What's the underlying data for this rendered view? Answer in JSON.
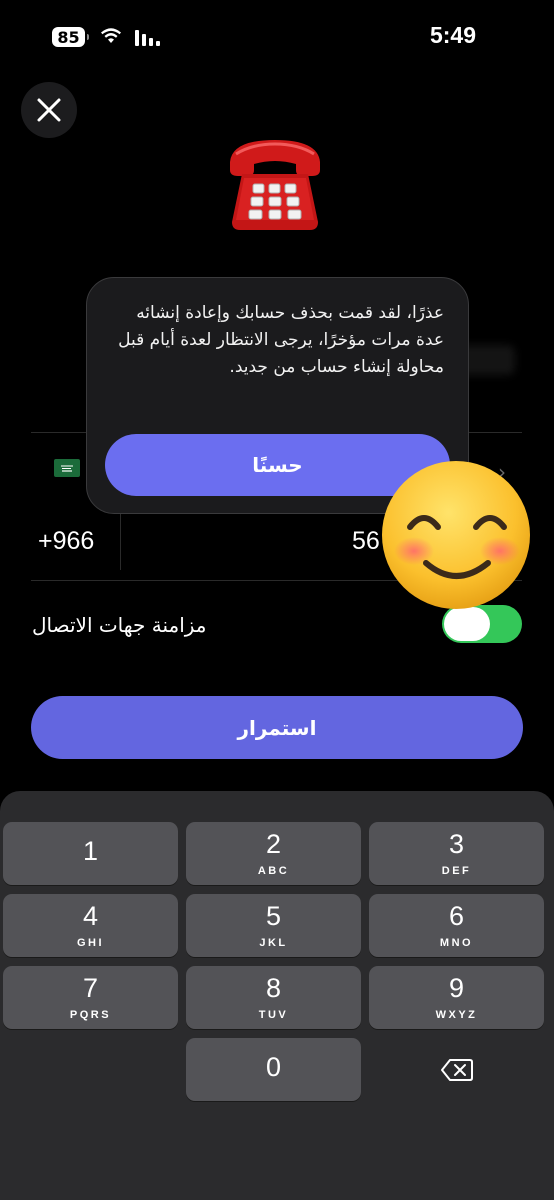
{
  "status_bar": {
    "battery_level": "85",
    "time": "5:49"
  },
  "form": {
    "country_code": "+966",
    "phone_number_visible": "56",
    "sync_contacts_label": "مزامنة جهات الاتصال",
    "sync_contacts_enabled": true,
    "continue_label": "استمرار"
  },
  "dialog": {
    "message": "عذرًا، لقد قمت بحذف حسابك وإعادة إنشائه عدة مرات مؤخرًا، يرجى الانتظار لعدة أيام قبل محاولة إنشاء حساب من جديد.",
    "ok_label": "حسنًا"
  },
  "keypad": {
    "keys": [
      {
        "num": "1",
        "letters": ""
      },
      {
        "num": "2",
        "letters": "ABC"
      },
      {
        "num": "3",
        "letters": "DEF"
      },
      {
        "num": "4",
        "letters": "GHI"
      },
      {
        "num": "5",
        "letters": "JKL"
      },
      {
        "num": "6",
        "letters": "MNO"
      },
      {
        "num": "7",
        "letters": "PQRS"
      },
      {
        "num": "8",
        "letters": "TUV"
      },
      {
        "num": "9",
        "letters": "WXYZ"
      },
      {
        "num": "0",
        "letters": ""
      }
    ]
  },
  "icons": {
    "close": "close-icon",
    "telephone": "telephone-emoji",
    "smile": "smiling-face-emoji",
    "backspace": "backspace-icon",
    "flag": "saudi-flag-icon"
  },
  "colors": {
    "accent": "#6366e0",
    "toggle_on": "#34c759",
    "keypad_bg": "#2b2b2d",
    "key_bg": "#535357"
  }
}
